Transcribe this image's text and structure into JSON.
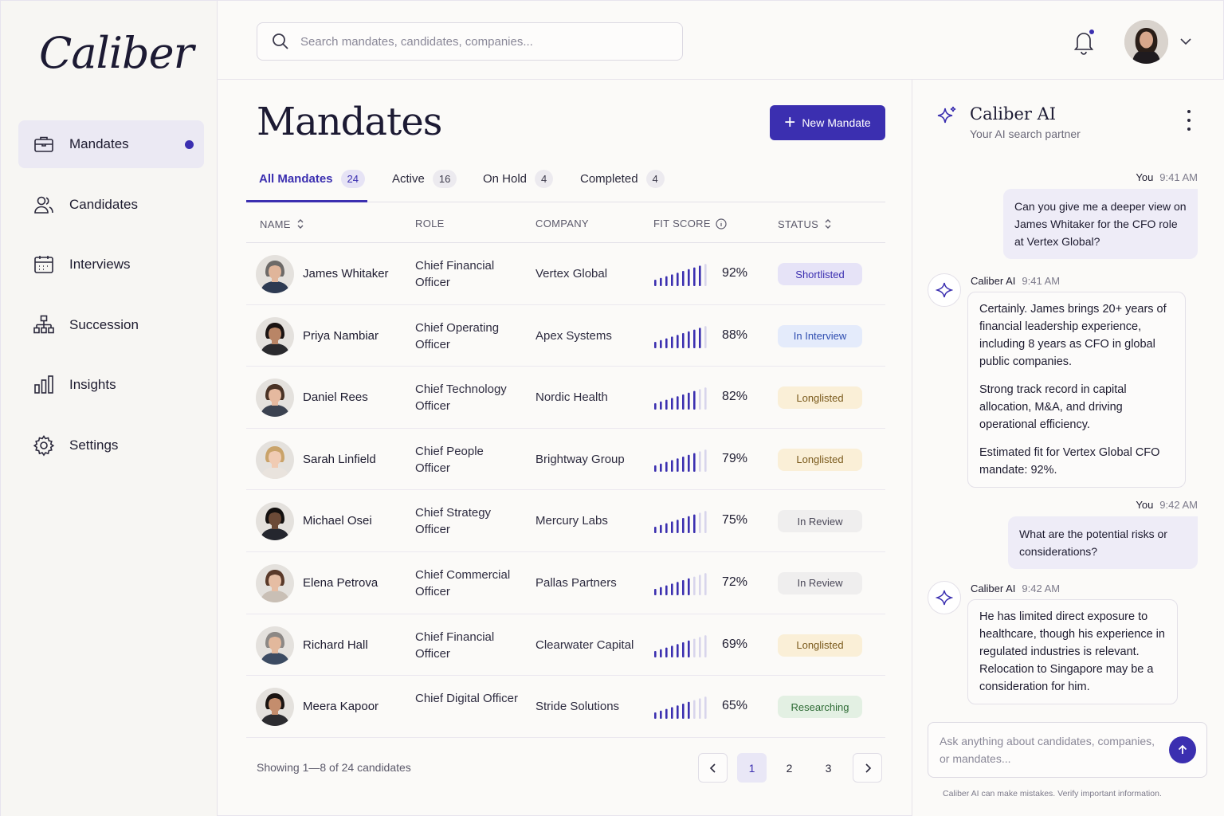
{
  "app": {
    "logo": "Caliber"
  },
  "sidebar": {
    "items": [
      {
        "label": "Mandates",
        "icon": "briefcase-icon",
        "active": true,
        "has_dot": true
      },
      {
        "label": "Candidates",
        "icon": "users-icon"
      },
      {
        "label": "Interviews",
        "icon": "calendar-icon"
      },
      {
        "label": "Succession",
        "icon": "org-chart-icon"
      },
      {
        "label": "Insights",
        "icon": "bar-chart-icon"
      },
      {
        "label": "Settings",
        "icon": "gear-icon"
      }
    ]
  },
  "topbar": {
    "search_placeholder": "Search mandates, candidates, companies..."
  },
  "main": {
    "title": "Mandates",
    "new_button": "New Mandate",
    "tabs": [
      {
        "label": "All Mandates",
        "count": "24",
        "active": true
      },
      {
        "label": "Active",
        "count": "16"
      },
      {
        "label": "On Hold",
        "count": "4"
      },
      {
        "label": "Completed",
        "count": "4"
      }
    ],
    "columns": {
      "name": "NAME",
      "role": "ROLE",
      "company": "COMPANY",
      "fit": "FIT SCORE",
      "status": "STATUS"
    },
    "rows": [
      {
        "name": "James Whitaker",
        "role": "Chief Financial Officer",
        "company": "Vertex Global",
        "fit": 92,
        "fit_label": "92%",
        "status": "Shortlisted",
        "status_kind": "shortlisted"
      },
      {
        "name": "Priya Nambiar",
        "role": "Chief Operating Officer",
        "company": "Apex Systems",
        "fit": 88,
        "fit_label": "88%",
        "status": "In Interview",
        "status_kind": "interview"
      },
      {
        "name": "Daniel Rees",
        "role": "Chief Technology Officer",
        "company": "Nordic Health",
        "fit": 82,
        "fit_label": "82%",
        "status": "Longlisted",
        "status_kind": "longlisted"
      },
      {
        "name": "Sarah Linfield",
        "role": "Chief People Officer",
        "company": "Brightway Group",
        "fit": 79,
        "fit_label": "79%",
        "status": "Longlisted",
        "status_kind": "longlisted"
      },
      {
        "name": "Michael Osei",
        "role": "Chief Strategy Officer",
        "company": "Mercury Labs",
        "fit": 75,
        "fit_label": "75%",
        "status": "In Review",
        "status_kind": "review"
      },
      {
        "name": "Elena Petrova",
        "role": "Chief Commercial Officer",
        "company": "Pallas Partners",
        "fit": 72,
        "fit_label": "72%",
        "status": "In Review",
        "status_kind": "review"
      },
      {
        "name": "Richard Hall",
        "role": "Chief Financial Officer",
        "company": "Clearwater Capital",
        "fit": 69,
        "fit_label": "69%",
        "status": "Longlisted",
        "status_kind": "longlisted"
      },
      {
        "name": "Meera Kapoor",
        "role": "Chief Digital Officer",
        "company": "Stride Solutions",
        "fit": 65,
        "fit_label": "65%",
        "status": "Researching",
        "status_kind": "researching"
      }
    ],
    "showing": "Showing 1—8 of 24 candidates",
    "pages": [
      "1",
      "2",
      "3"
    ],
    "current_page": "1"
  },
  "ai": {
    "title": "Caliber AI",
    "subtitle": "Your AI search partner",
    "messages": [
      {
        "from": "You",
        "time": "9:41 AM",
        "text": "Can you give me a deeper view on James Whitaker for the CFO role at Vertex Global?"
      },
      {
        "from": "Caliber AI",
        "time": "9:41 AM",
        "paragraphs": [
          "Certainly. James brings 20+ years of financial leadership experience, including 8 years as CFO in global public companies.",
          "Strong track record in capital allocation, M&A, and driving operational efficiency.",
          "Estimated fit for Vertex Global CFO mandate: 92%."
        ]
      },
      {
        "from": "You",
        "time": "9:42 AM",
        "text": "What are the potential risks or considerations?"
      },
      {
        "from": "Caliber AI",
        "time": "9:42 AM",
        "paragraphs": [
          "He has limited direct exposure to healthcare, though his experience in regulated industries is relevant. Relocation to Singapore may be a consideration for him."
        ]
      }
    ],
    "input_placeholder": "Ask anything about candidates, companies, or mandates...",
    "disclaimer": "Caliber AI can make mistakes. Verify important information."
  },
  "colors": {
    "accent": "#3b2fb0",
    "shortlisted_bg": "#e6e3f7",
    "shortlisted_fg": "#3b2fb0",
    "interview_bg": "#e4ebfb",
    "interview_fg": "#2f4db0",
    "longlisted_bg": "#faefd7",
    "longlisted_fg": "#7a5a1c",
    "review_bg": "#efeeee",
    "review_fg": "#4a4858",
    "researching_bg": "#e3f0e3",
    "researching_fg": "#2e6b35"
  }
}
